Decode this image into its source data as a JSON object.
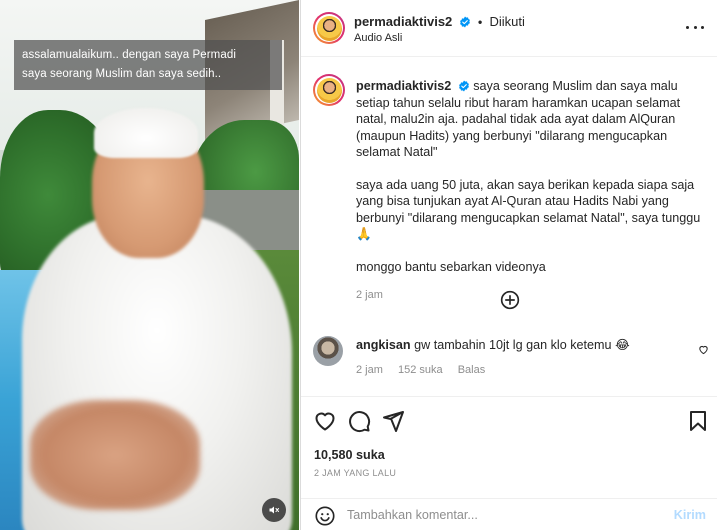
{
  "video": {
    "overlay_lines": [
      "assalamualaikum.. dengan saya Permadi",
      "saya seorang Muslim dan saya sedih.."
    ],
    "mute_icon": "speaker-muted-icon"
  },
  "header": {
    "username": "permadiaktivis2",
    "verified_icon": "verified-badge-icon",
    "separator": "•",
    "follow_state": "Diikuti",
    "subline": "Audio Asli",
    "more_icon": "more-options-icon"
  },
  "caption": {
    "username": "permadiaktivis2",
    "paragraph1": "saya seorang Muslim dan saya malu setiap tahun selalu ribut haram haramkan ucapan selamat natal, malu2in aja. padahal tidak ada ayat dalam AlQuran (maupun Hadits) yang berbunyi \"dilarang mengucapkan selamat Natal\"",
    "paragraph2": "saya ada uang 50 juta, akan saya berikan kepada siapa saja yang bisa tunjukan ayat Al-Quran atau Hadits Nabi yang berbunyi \"dilarang mengucapkan selamat Natal\", saya tunggu 🙏",
    "paragraph3": "monggo bantu sebarkan videonya",
    "time": "2 jam"
  },
  "load_more_icon": "plus-circle-icon",
  "comment": {
    "username": "angkisan",
    "text": "gw tambahin 10jt lg gan klo ketemu 😂",
    "time": "2 jam",
    "likes": "152 suka",
    "reply": "Balas"
  },
  "actions": {
    "likes": "10,580 suka",
    "ago": "2 JAM YANG LALU"
  },
  "add_comment": {
    "placeholder": "Tambahkan komentar...",
    "post_label": "Kirim"
  },
  "colors": {
    "text": "#262626",
    "muted": "#8e8e8e",
    "verified": "#0095f6",
    "post_disabled": "#b3dbff"
  }
}
